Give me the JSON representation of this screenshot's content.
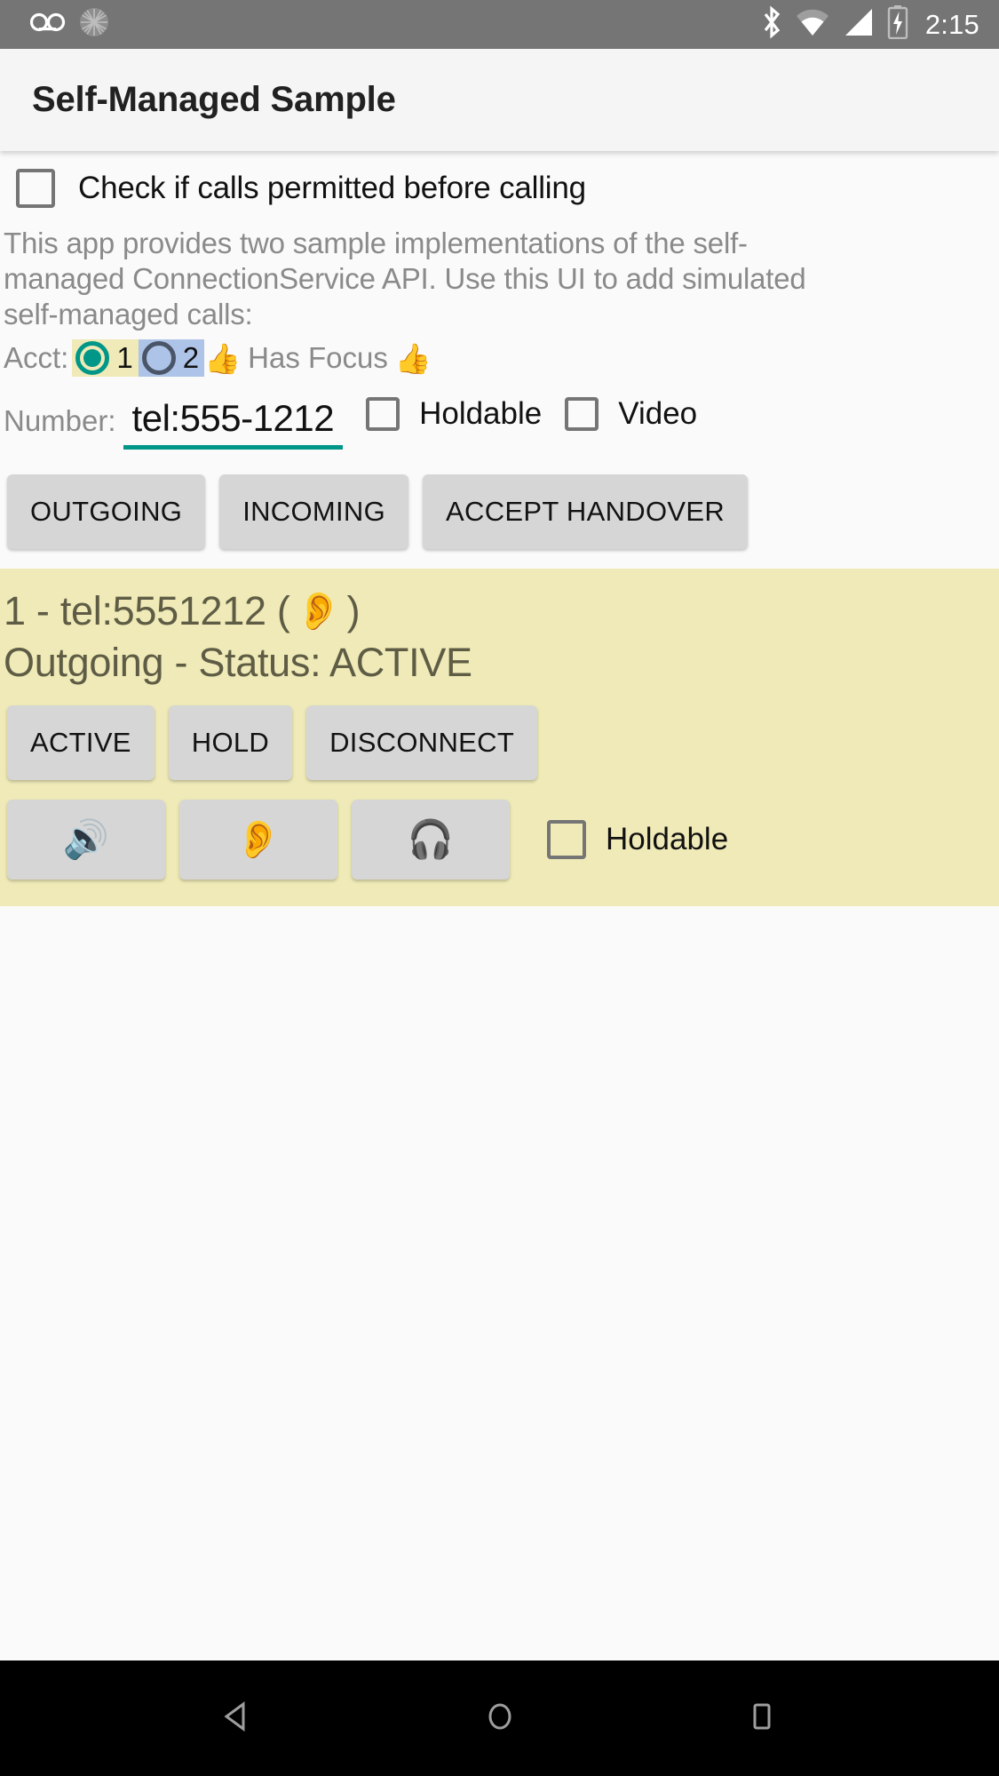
{
  "status_bar": {
    "icons_left": [
      "voicemail-icon",
      "sync-circle-icon"
    ],
    "icons_right": [
      "bluetooth-icon",
      "wifi-icon",
      "signal-icon",
      "battery-charging-icon"
    ],
    "time": "2:15"
  },
  "app_bar": {
    "title": "Self-Managed Sample"
  },
  "permission": {
    "checkbox_label": "Check if calls permitted before calling",
    "checked": false
  },
  "description": "This app provides two sample implementations of the self-managed ConnectionService API.  Use this UI to add simulated self-managed calls:",
  "account": {
    "label": "Acct:",
    "options": [
      {
        "value": "1",
        "selected": true,
        "highlight": "#efeab7"
      },
      {
        "value": "2",
        "selected": false,
        "highlight": "#adc3e8"
      }
    ],
    "focus_emoji_left": "👍",
    "focus_text": "Has Focus",
    "focus_emoji_right": "👍"
  },
  "number": {
    "label": "Number:",
    "value": "tel:555-1212",
    "placeholder": "tel:555-1212",
    "holdable_label": "Holdable",
    "holdable_checked": false,
    "video_label": "Video",
    "video_checked": false
  },
  "actions": [
    {
      "label": "OUTGOING"
    },
    {
      "label": "INCOMING"
    },
    {
      "label": "ACCEPT HANDOVER"
    }
  ],
  "call": {
    "title_prefix": "1 - tel:5551212 (",
    "title_emoji": "👂",
    "title_suffix": ")",
    "status_line": "Outgoing - Status: ACTIVE",
    "state_buttons": [
      {
        "label": "ACTIVE"
      },
      {
        "label": "HOLD"
      },
      {
        "label": "DISCONNECT"
      }
    ],
    "audio_buttons": [
      {
        "emoji": "🔊",
        "name": "speaker-icon"
      },
      {
        "emoji": "👂",
        "name": "ear-icon"
      },
      {
        "emoji": "🎧",
        "name": "headphones-icon"
      }
    ],
    "holdable_label": "Holdable",
    "holdable_checked": false,
    "background_color": "#efeab7",
    "text_color": "#5e5c45"
  },
  "nav_bar": {
    "back": "back-icon",
    "home": "home-icon",
    "recents": "recents-icon"
  }
}
